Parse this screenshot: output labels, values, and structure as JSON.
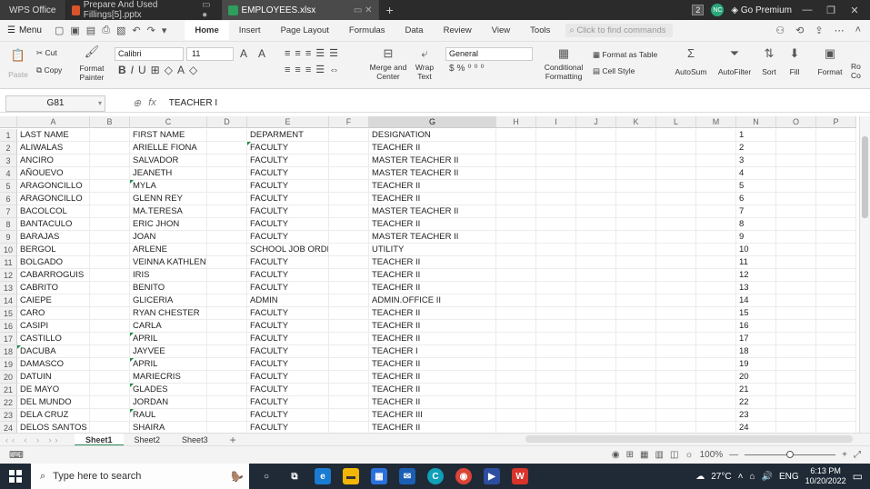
{
  "titlebar": {
    "app_name": "WPS Office",
    "tabs": [
      {
        "label": "Prepare And Used Fillings[5].pptx",
        "icon": "presentation-icon",
        "color": "#d9542b"
      },
      {
        "label": "EMPLOYEES.xlsx",
        "icon": "spreadsheet-icon",
        "color": "#2e9e5b"
      }
    ],
    "badge": "2",
    "avatar": "NC",
    "premium": "Go Premium"
  },
  "menubar": {
    "menu_label": "Menu",
    "tabs": [
      "Home",
      "Insert",
      "Page Layout",
      "Formulas",
      "Data",
      "Review",
      "View",
      "Tools"
    ],
    "active_tab": "Home",
    "find_placeholder": "Click to find commands"
  },
  "ribbon": {
    "paste": "Paste",
    "cut": "Cut",
    "copy": "Copy",
    "format_painter_1": "Format",
    "format_painter_2": "Painter",
    "font": "Calibri",
    "size": "11",
    "merge_1": "Merge and",
    "merge_2": "Center",
    "wrap_1": "Wrap",
    "wrap_2": "Text",
    "number_format": "General",
    "conditional_1": "Conditional",
    "conditional_2": "Formatting",
    "format_as_table": "Format as Table",
    "cell_style": "Cell Style",
    "autosum": "AutoSum",
    "autofilter": "AutoFilter",
    "sort": "Sort",
    "fill": "Fill",
    "format": "Format",
    "rows_cols_1": "Ro",
    "rows_cols_2": "Co"
  },
  "formula_bar": {
    "cell_ref": "G81",
    "fx": "fx",
    "value": "TEACHER I"
  },
  "sheet": {
    "columns": [
      "A",
      "B",
      "C",
      "D",
      "E",
      "F",
      "G",
      "H",
      "I",
      "J",
      "K",
      "L",
      "M",
      "N",
      "O",
      "P"
    ],
    "selected_column": "G",
    "rows": [
      {
        "n": "1",
        "a": "LAST NAME",
        "c": "FIRST NAME",
        "e": "DEPARMENT",
        "g": "DESIGNATION"
      },
      {
        "n": "2",
        "a": "ALIWALAS",
        "c": "ARIELLE FIONA",
        "e": "FACULTY",
        "g": "TEACHER II"
      },
      {
        "n": "3",
        "a": "ANCIRO",
        "c": "SALVADOR",
        "e": "FACULTY",
        "g": "MASTER TEACHER II"
      },
      {
        "n": "4",
        "a": "AÑOUEVO",
        "c": "JEANETH",
        "e": "FACULTY",
        "g": "MASTER TEACHER II"
      },
      {
        "n": "5",
        "a": "ARAGONCILLO",
        "c": "MYLA",
        "e": "FACULTY",
        "g": "TEACHER II"
      },
      {
        "n": "6",
        "a": "ARAGONCILLO",
        "c": "GLENN REY",
        "e": "FACULTY",
        "g": "TEACHER II"
      },
      {
        "n": "7",
        "a": "BACOLCOL",
        "c": "MA.TERESA",
        "e": "FACULTY",
        "g": "MASTER TEACHER II"
      },
      {
        "n": "8",
        "a": "BANTACULO",
        "c": "ERIC JHON",
        "e": "FACULTY",
        "g": "TEACHER II"
      },
      {
        "n": "9",
        "a": "BARAJAS",
        "c": "JOAN",
        "e": "FACULTY",
        "g": "MASTER TEACHER II"
      },
      {
        "n": "10",
        "a": "BERGOL",
        "c": "ARLENE",
        "e": "SCHOOL JOB ORDER",
        "g": "UTILITY"
      },
      {
        "n": "11",
        "a": "BOLGADO",
        "c": "VEINNA KATHLENE",
        "e": "FACULTY",
        "g": "TEACHER II"
      },
      {
        "n": "12",
        "a": "CABARROGUIS",
        "c": "IRIS",
        "e": "FACULTY",
        "g": "TEACHER II"
      },
      {
        "n": "13",
        "a": "CABRITO",
        "c": "BENITO",
        "e": "FACULTY",
        "g": "TEACHER II"
      },
      {
        "n": "14",
        "a": "CAIEPE",
        "c": "GLICERIA",
        "e": "ADMIN",
        "g": "ADMIN.OFFICE II"
      },
      {
        "n": "15",
        "a": "CARO",
        "c": "RYAN CHESTER",
        "e": "FACULTY",
        "g": "TEACHER II"
      },
      {
        "n": "16",
        "a": "CASIPI",
        "c": "CARLA",
        "e": "FACULTY",
        "g": "TEACHER II"
      },
      {
        "n": "17",
        "a": "CASTILLO",
        "c": "APRIL",
        "e": "FACULTY",
        "g": "TEACHER II"
      },
      {
        "n": "18",
        "a": "DACUBA",
        "c": "JAYVEE",
        "e": "FACULTY",
        "g": "TEACHER I"
      },
      {
        "n": "19",
        "a": "DAMASCO",
        "c": "APRIL",
        "e": "FACULTY",
        "g": "TEACHER II"
      },
      {
        "n": "20",
        "a": "DATUIN",
        "c": "MARIECRIS",
        "e": "FACULTY",
        "g": "TEACHER II"
      },
      {
        "n": "21",
        "a": "DE MAYO",
        "c": "GLADES",
        "e": "FACULTY",
        "g": "TEACHER II"
      },
      {
        "n": "22",
        "a": "DEL MUNDO",
        "c": "JORDAN",
        "e": "FACULTY",
        "g": "TEACHER II"
      },
      {
        "n": "23",
        "a": "DELA CRUZ",
        "c": "RAUL",
        "e": "FACULTY",
        "g": "TEACHER III"
      },
      {
        "n": "24",
        "a": "DELOS SANTOS",
        "c": "SHAIRA",
        "e": "FACULTY",
        "g": "TEACHER II"
      }
    ]
  },
  "sheet_tabs": [
    "Sheet1",
    "Sheet2",
    "Sheet3"
  ],
  "active_sheet": "Sheet1",
  "status": {
    "zoom": "100%"
  },
  "taskbar": {
    "search_placeholder": "Type here to search",
    "temperature": "27°C",
    "language": "ENG",
    "time": "6:13 PM",
    "date": "10/20/2022"
  }
}
